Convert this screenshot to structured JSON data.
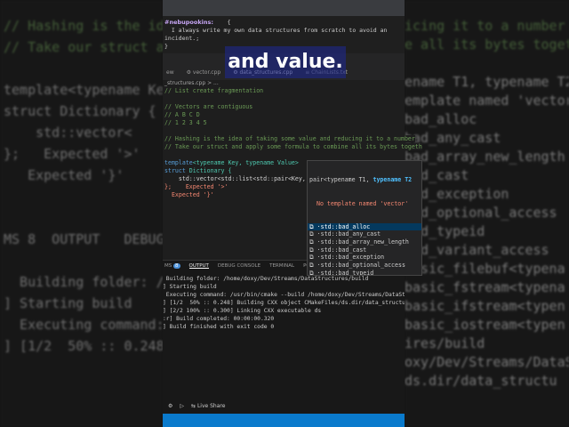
{
  "caption": "and value.",
  "chat": {
    "user": "#nebupookins:",
    "open": "{",
    "line1": "  I always write my own data structures from scratch to avoid an",
    "line2": "incident.;",
    "close": "}"
  },
  "tabs": [
    "ew",
    "⚙ vector.cpp",
    "⚙ data_structures.cpp",
    "≡ ChainLists.txt"
  ],
  "breadcrumb": "_structures.cpp > ...",
  "code": {
    "l1": "// List create fragmentation",
    "l2": "// Vectors are contiguous",
    "l3": "// A B C D",
    "l4": "// 1 2 3 4 5",
    "l5": "// Hashing is the idea of taking some value and reducing it to a number",
    "l6": "// Take our struct and apply some formula to combine all its bytes togeth",
    "l7a": "template",
    "l7b": "<typename Key, typename Value>",
    "l8a": "struct ",
    "l8b": "Dictionary {",
    "l9": "    std::vector<std::list<std::pair<Key, Ba",
    "l10a": "};",
    "l10b": "    Expected '>'",
    "l11": "  Expected '}'"
  },
  "autocomplete": {
    "signature": "pair<typename T1, ",
    "signature_bold": "typename T2",
    "error": "No template named 'vector'",
    "items": [
      "bad_alloc",
      "bad_any_cast",
      "bad_array_new_length",
      "bad_cast",
      "bad_exception",
      "bad_optional_access",
      "bad_typeid",
      "bad_variant_access",
      "basic_filebuf<typenam",
      "basic_fstream<typenam",
      "basic_ifstream<typena",
      "basic_iostream<typena"
    ],
    "prefix": "⧉ ·std::"
  },
  "panel": {
    "tabs": [
      "MS",
      "OUTPUT",
      "DEBUG CONSOLE",
      "TERMINAL",
      "PORTS"
    ],
    "badge": "8",
    "lines": [
      " Building folder: /home/doxy/Dev/Streams/DataStructures/build",
      "] Starting build",
      " Executing command: /usr/bin/cmake --build /home/doxy/Dev/Streams/DataSt",
      "] [1/2  50% :: 0.248] Building CXX object CMakeFiles/ds.dir/data_structu",
      "] [2/2 100% :: 0.300] Linking CXX executable ds",
      ":r] Build completed: 00:00:00.320",
      "] Build finished with exit code 0"
    ]
  },
  "status": {
    "live_share": "Live Share"
  },
  "bg_left": [
    "// Hashing is the ide",
    "// Take our struct a",
    "",
    "template<typename Key",
    "struct Dictionary {",
    "    std::vector<",
    "};   Expected '>'",
    "   Expected '}'",
    "",
    "",
    "MS 8  OUTPUT   DEBUG CO",
    "",
    "  Building folder: /ho",
    "] Starting build",
    "  Executing command: /",
    "] [1/2  50% :: 0.248]"
  ],
  "bg_right": [
    "icing it to a number",
    "e all its bytes toget",
    "",
    "ename T1, typename T2",
    "emplate named 'vector",
    "bad_alloc",
    "bad_any_cast",
    "bad_array_new_length",
    "bad_cast",
    "bad_exception",
    "bad_optional_access",
    "bad_typeid",
    "bad_variant_access",
    "basic_filebuf<typena",
    "basic_fstream<typena",
    "basic_ifstream<typen",
    "basic_iostream<typen",
    "ires/build",
    "oxy/Dev/Streams/DataStr",
    "ds.dir/data_structu"
  ]
}
